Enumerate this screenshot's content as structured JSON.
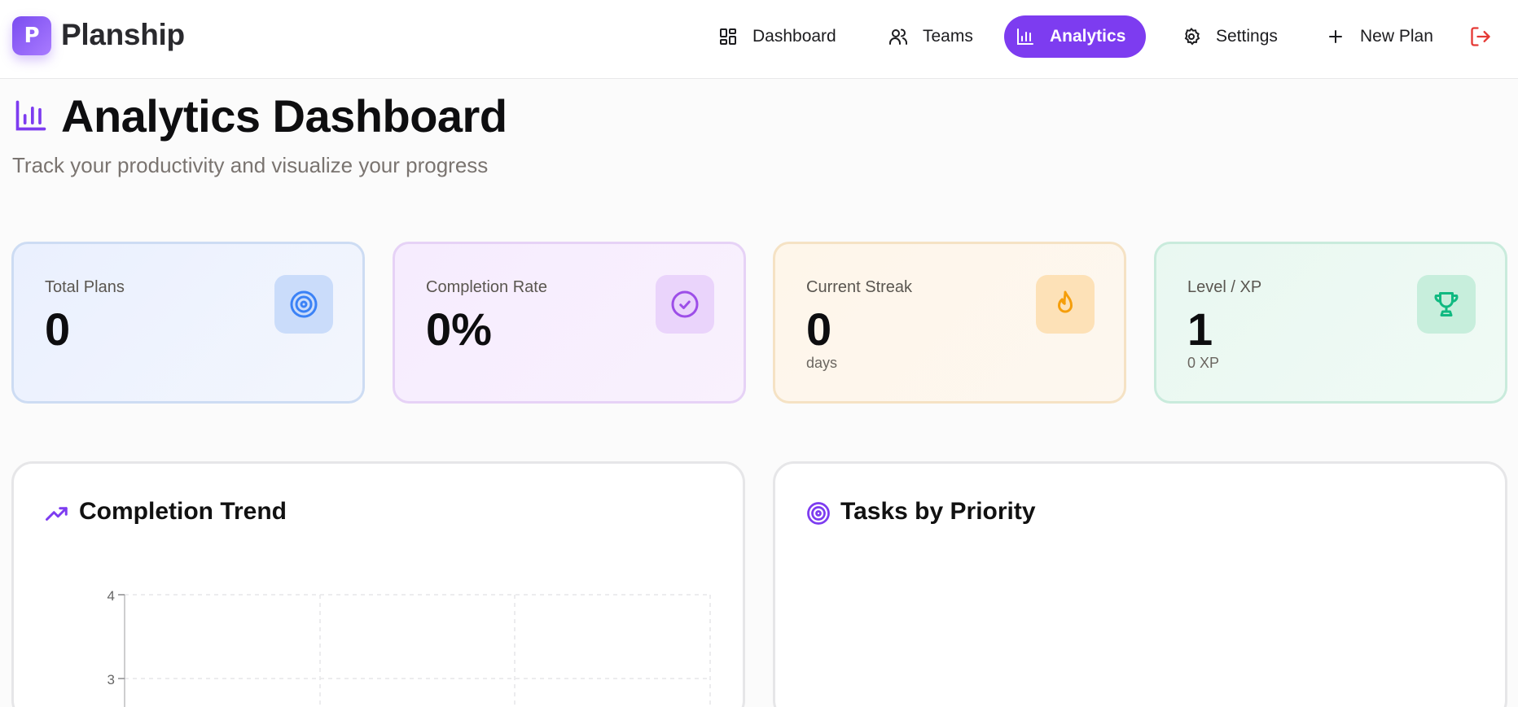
{
  "header": {
    "logo_letter": "P",
    "brand": "Planship",
    "nav": [
      {
        "label": "Dashboard",
        "icon": "dashboard-icon"
      },
      {
        "label": "Teams",
        "icon": "users-icon"
      },
      {
        "label": "Analytics",
        "icon": "bar-chart-icon",
        "active": true
      },
      {
        "label": "Settings",
        "icon": "gear-icon"
      },
      {
        "label": "New Plan",
        "icon": "plus-icon"
      }
    ],
    "logout_icon": "logout-icon"
  },
  "page": {
    "title": "Analytics Dashboard",
    "subtitle": "Track your productivity and visualize your progress"
  },
  "stats": [
    {
      "label": "Total Plans",
      "value": "0",
      "sub": "",
      "icon": "target-icon",
      "color": "#3b82f6"
    },
    {
      "label": "Completion Rate",
      "value": "0%",
      "sub": "",
      "icon": "check-circle-icon",
      "color": "#9d4ee8"
    },
    {
      "label": "Current Streak",
      "value": "0",
      "sub": "days",
      "icon": "flame-icon",
      "color": "#f59e0b"
    },
    {
      "label": "Level / XP",
      "value": "1",
      "sub": "0 XP",
      "icon": "trophy-icon",
      "color": "#10b981"
    }
  ],
  "panels": {
    "trend": {
      "title": "Completion Trend",
      "icon": "trending-up-icon"
    },
    "priority": {
      "title": "Tasks by Priority",
      "icon": "target-icon"
    }
  },
  "chart_data": {
    "type": "line",
    "title": "Completion Trend",
    "y_ticks": [
      "4",
      "3"
    ],
    "ylim": [
      0,
      4
    ],
    "grid": true,
    "series": []
  },
  "colors": {
    "accent": "#7d3cf0",
    "logout": "#e53935"
  }
}
